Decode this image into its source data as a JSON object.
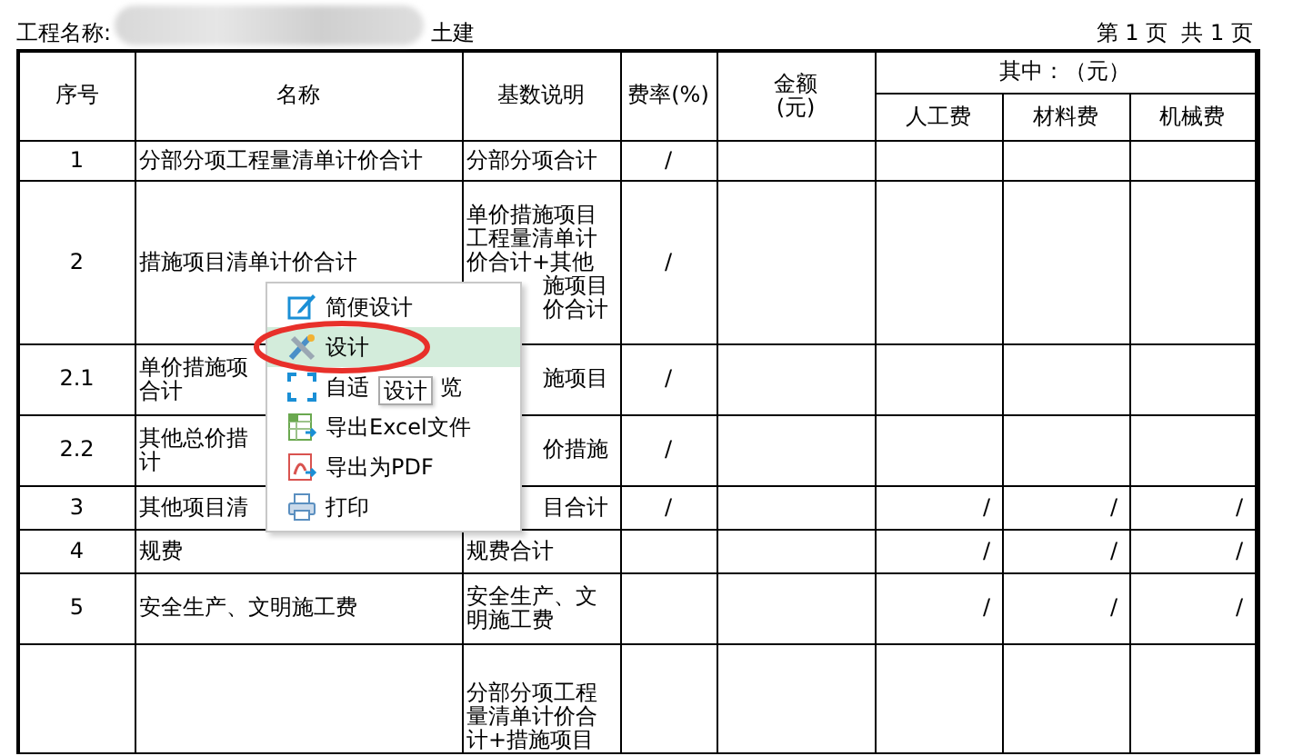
{
  "header": {
    "project_label": "工程名称:",
    "project_type": "土建",
    "page_info": "第 1 页  共 1 页"
  },
  "table": {
    "columns": [
      {
        "label": "序号"
      },
      {
        "label": "名称"
      },
      {
        "label": "基数说明"
      },
      {
        "label": "费率(%)"
      },
      {
        "label": "金额\n(元)"
      }
    ],
    "group": {
      "label": "其中：（元）",
      "columns": [
        {
          "label": "人工费"
        },
        {
          "label": "材料费"
        },
        {
          "label": "机械费"
        }
      ]
    },
    "rows": [
      {
        "no": "1",
        "name": [
          "分部分项工程量清单计价合计"
        ],
        "base": [
          {
            "text": "分部分项合计",
            "kind": "full"
          }
        ],
        "rate": "/",
        "labor": "",
        "material": "",
        "machine": ""
      },
      {
        "no": "2",
        "name": [
          "措施项目清单计价合计"
        ],
        "base": [
          {
            "text": "单价措施项目",
            "kind": "full"
          },
          {
            "text": "工程量清单计",
            "kind": "full"
          },
          {
            "text": "价合计+其他",
            "kind": "full"
          },
          {
            "text": "施项目",
            "kind": "tail"
          },
          {
            "text": "价合计",
            "kind": "tail"
          }
        ],
        "rate": "/",
        "labor": "",
        "material": "",
        "machine": ""
      },
      {
        "no": "2.1",
        "name": [
          "单价措施项",
          "合计"
        ],
        "base": [
          {
            "text": "施项目",
            "kind": "tail"
          }
        ],
        "rate": "/",
        "labor": "",
        "material": "",
        "machine": ""
      },
      {
        "no": "2.2",
        "name": [
          "其他总价措",
          "计"
        ],
        "base": [
          {
            "text": "价措施",
            "kind": "tail"
          }
        ],
        "rate": "/",
        "labor": "",
        "material": "",
        "machine": ""
      },
      {
        "no": "3",
        "name": [
          "其他项目清"
        ],
        "base": [
          {
            "text": "目合计",
            "kind": "tail"
          }
        ],
        "rate": "/",
        "labor": "/",
        "material": "/",
        "machine": "/"
      },
      {
        "no": "4",
        "name": [
          "规费"
        ],
        "base": [
          {
            "text": "规费合计",
            "kind": "full"
          }
        ],
        "rate": "",
        "labor": "/",
        "material": "/",
        "machine": "/"
      },
      {
        "no": "5",
        "name": [
          "安全生产、文明施工费"
        ],
        "base": [
          {
            "text": "安全生产、文",
            "kind": "full"
          },
          {
            "text": "明施工费",
            "kind": "full"
          }
        ],
        "rate": "",
        "labor": "/",
        "material": "/",
        "machine": "/"
      },
      {
        "no": "",
        "name": [],
        "base": [
          {
            "text": "分部分项工程",
            "kind": "full"
          },
          {
            "text": "量清单计价合",
            "kind": "full"
          },
          {
            "text": "计+措施项目",
            "kind": "full"
          }
        ],
        "rate": "",
        "labor": "",
        "material": "",
        "machine": ""
      }
    ]
  },
  "context_menu": {
    "items": [
      {
        "label": "简便设计",
        "selected": false
      },
      {
        "label": "设计",
        "selected": true
      },
      {
        "label": "自适",
        "label_tail": "览",
        "selected": false
      },
      {
        "label": "导出Excel文件",
        "selected": false
      },
      {
        "label": "导出为PDF",
        "selected": false
      },
      {
        "label": "打印",
        "selected": false
      }
    ],
    "tooltip": "设计"
  }
}
